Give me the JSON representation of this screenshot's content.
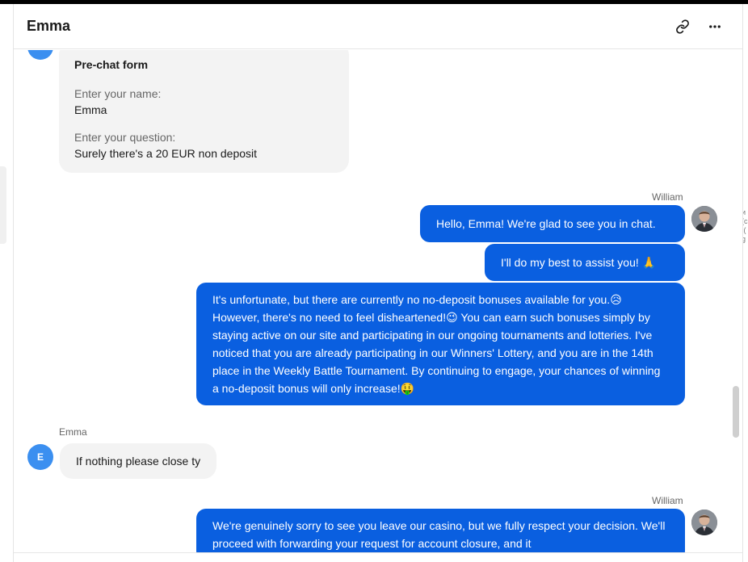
{
  "header": {
    "title": "Emma"
  },
  "side_edge_text": "и\n(c\n:(\ng",
  "prechat": {
    "heading": "Pre-chat form",
    "name_label": "Enter your name:",
    "name_value": "Emma",
    "question_label": "Enter your question:",
    "question_value": "Surely there's a 20 EUR non deposit"
  },
  "messages": {
    "operator_name_1": "William",
    "op_msg_1": "Hello, Emma! We're glad to see you in chat.",
    "op_msg_2": "I'll do my best to assist you! 🙏",
    "op_msg_3": "It's unfortunate, but there are currently no no-deposit bonuses available for you.😥 However, there's no need to feel disheartened!😉 You can earn such bonuses simply by staying active on our site and participating in our ongoing tournaments and lotteries. I've noticed that you are already participating in our Winners' Lottery, and you are in the 14th place in the Weekly Battle Tournament. By continuing to engage, your chances of winning a no-deposit bonus will only increase!🤑",
    "user_name": "Emma",
    "user_initial": "E",
    "user_msg_1": "If nothing please close ty",
    "operator_name_2": "William",
    "op_msg_4": "We're genuinely sorry to see you leave our casino, but we fully respect your decision. We'll proceed with forwarding your request for account closure, and it"
  },
  "colors": {
    "operator_bubble": "#0a5fe0",
    "user_bubble": "#f3f3f3",
    "avatar": "#3b8ff0"
  },
  "icons": {
    "link": "link-icon",
    "more": "more-icon"
  }
}
